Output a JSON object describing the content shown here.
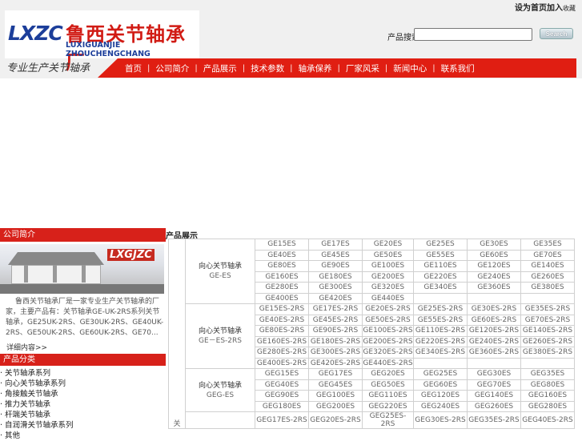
{
  "header": {
    "logo_mark": "LXZC",
    "logo_cn": "鲁西关节轴承厂",
    "logo_en": "LUXIGUANJIE ZHOUCHENGCHANG",
    "top_link_bold": "设为首页加入",
    "top_link_small": "收藏",
    "slogan": "专业生产关节轴承",
    "search_label": "产品搜索：",
    "search_value": "",
    "search_button": "Search"
  },
  "nav": [
    "首页",
    "公司简介",
    "产品展示",
    "技术参数",
    "轴承保养",
    "厂家风采",
    "新闻中心",
    "联系我们"
  ],
  "sidebar": {
    "about_title": "公司简介",
    "photo_text": "LXGJZC",
    "intro_text": "鲁西关节轴承厂是一家专业生产关节轴承的厂家，主要产品有：关节轴承GE-UK-2RS系列关节轴承，GE25UK-2RS、GE30UK-2RS、GE40UK-2RS、GE50UK-2RS、GE60UK-2RS、GE70...",
    "more": "详细内容>>",
    "cat_title": "产品分类",
    "categories": [
      "关节轴承系列",
      "向心关节轴承系列",
      "角接触关节轴承",
      "推力关节轴承",
      "杆端关节轴承",
      "自润滑关节轴承系列",
      "其他"
    ]
  },
  "main": {
    "title": "产品展示",
    "gutter_text": "关",
    "groups": [
      {
        "name": "向心关节轴承",
        "code": "GE-ES",
        "rows": [
          [
            "GE15ES",
            "GE17ES",
            "GE20ES",
            "GE25ES",
            "GE30ES",
            "GE35ES"
          ],
          [
            "GE40ES",
            "GE45ES",
            "GE50ES",
            "GE55ES",
            "GE60ES",
            "GE70ES"
          ],
          [
            "GE80ES",
            "GE90ES",
            "GE100ES",
            "GE110ES",
            "GE120ES",
            "GE140ES"
          ],
          [
            "GE160ES",
            "GE180ES",
            "GE200ES",
            "GE220ES",
            "GE240ES",
            "GE260ES"
          ],
          [
            "GE280ES",
            "GE300ES",
            "GE320ES",
            "GE340ES",
            "GE360ES",
            "GE380ES"
          ],
          [
            "GE400ES",
            "GE420ES",
            "GE440ES",
            "",
            "",
            ""
          ]
        ]
      },
      {
        "name": "向心关节轴承",
        "code": "GE－ES-2RS",
        "rows": [
          [
            "GE15ES-2RS",
            "GE17ES-2RS",
            "GE20ES-2RS",
            "GE25ES-2RS",
            "GE30ES-2RS",
            "GE35ES-2RS"
          ],
          [
            "GE40ES-2RS",
            "GE45ES-2RS",
            "GE50ES-2RS",
            "GE55ES-2RS",
            "GE60ES-2RS",
            "GE70ES-2RS"
          ],
          [
            "GE80ES-2RS",
            "GE90ES-2RS",
            "GE100ES-2RS",
            "GE110ES-2RS",
            "GE120ES-2RS",
            "GE140ES-2RS"
          ],
          [
            "GE160ES-2RS",
            "GE180ES-2RS",
            "GE200ES-2RS",
            "GE220ES-2RS",
            "GE240ES-2RS",
            "GE260ES-2RS"
          ],
          [
            "GE280ES-2RS",
            "GE300ES-2RS",
            "GE320ES-2RS",
            "GE340ES-2RS",
            "GE360ES-2RS",
            "GE380ES-2RS"
          ],
          [
            "GE400ES-2RS",
            "GE420ES-2RS",
            "GE440ES-2RS",
            "",
            "",
            ""
          ]
        ]
      },
      {
        "name": "向心关节轴承",
        "code": "GEG-ES",
        "rows": [
          [
            "GEG15ES",
            "GEG17ES",
            "GEG20ES",
            "GEG25ES",
            "GEG30ES",
            "GEG35ES"
          ],
          [
            "GEG40ES",
            "GEG45ES",
            "GEG50ES",
            "GEG60ES",
            "GEG70ES",
            "GEG80ES"
          ],
          [
            "GEG90ES",
            "GEG100ES",
            "GEG110ES",
            "GEG120ES",
            "GEG140ES",
            "GEG160ES"
          ],
          [
            "GEG180ES",
            "GEG200ES",
            "GEG220ES",
            "GEG240ES",
            "GEG260ES",
            "GEG280ES"
          ]
        ]
      },
      {
        "name": "",
        "code": "",
        "rows": [
          [
            "GEG17ES-2RS",
            "GEG20ES-2RS",
            "GEG25ES-2RS",
            "GEG30ES-2RS",
            "GEG35ES-2RS",
            "GEG40ES-2RS"
          ]
        ]
      }
    ]
  }
}
